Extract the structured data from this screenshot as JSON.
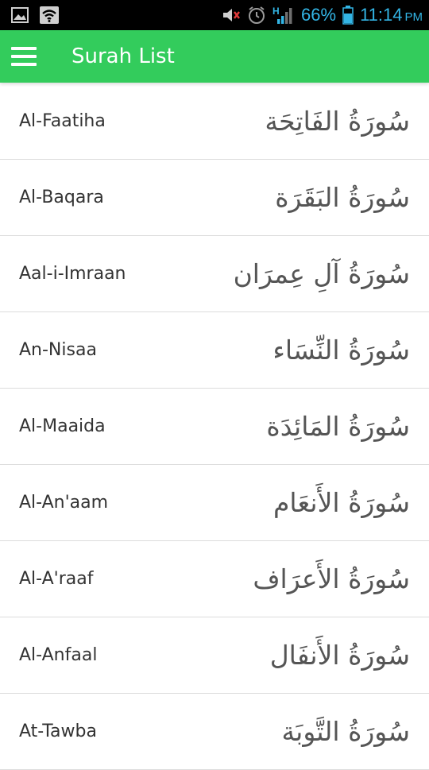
{
  "status_bar": {
    "battery_percent": "66%",
    "time": "11:14",
    "ampm": "PM",
    "network_type": "H",
    "accent_color": "#33b5e5",
    "icons": [
      "image-icon",
      "wifi-icon",
      "mute-icon",
      "alarm-icon",
      "signal-icon",
      "battery-icon"
    ]
  },
  "app_bar": {
    "title": "Surah List",
    "color": "#33cc5c",
    "menu_icon": "hamburger-menu-icon"
  },
  "surahs": [
    {
      "name": "Al-Faatiha",
      "arabic": "سُورَةُ الفَاتِحَة"
    },
    {
      "name": "Al-Baqara",
      "arabic": "سُورَةُ البَقَرَة"
    },
    {
      "name": "Aal-i-Imraan",
      "arabic": "سُورَةُ آلِ عِمرَان"
    },
    {
      "name": "An-Nisaa",
      "arabic": "سُورَةُ النِّسَاء"
    },
    {
      "name": "Al-Maaida",
      "arabic": "سُورَةُ المَائِدَة"
    },
    {
      "name": "Al-An'aam",
      "arabic": "سُورَةُ الأَنعَام"
    },
    {
      "name": "Al-A'raaf",
      "arabic": "سُورَةُ الأَعرَاف"
    },
    {
      "name": "Al-Anfaal",
      "arabic": "سُورَةُ الأَنفَال"
    },
    {
      "name": "At-Tawba",
      "arabic": "سُورَةُ التَّوبَة"
    }
  ]
}
